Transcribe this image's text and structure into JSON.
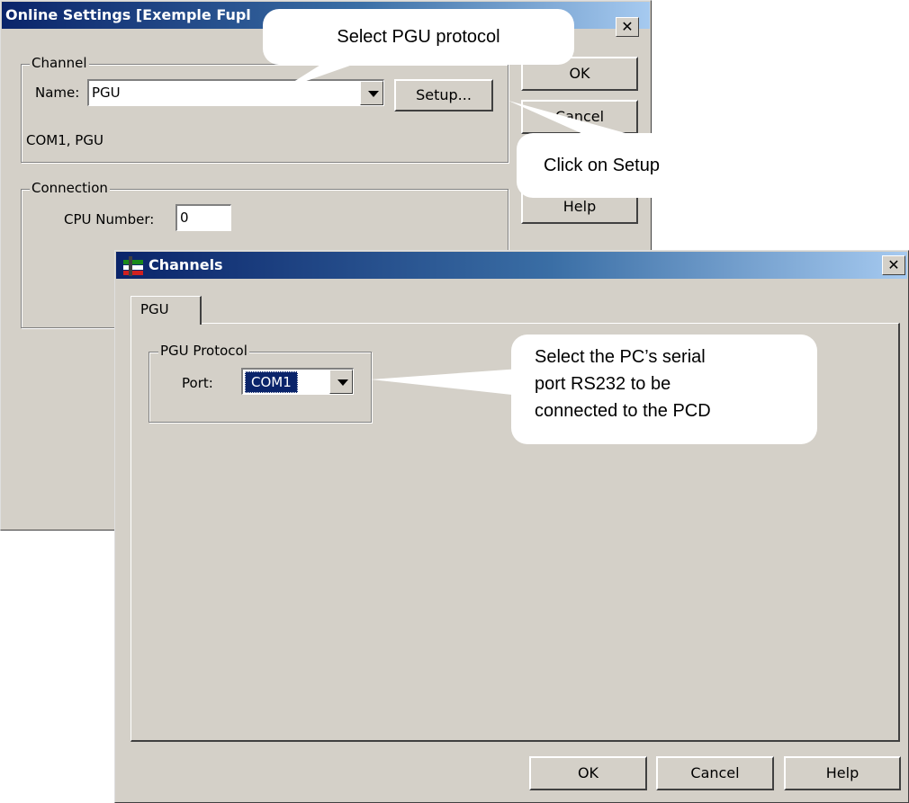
{
  "online_settings": {
    "title": "Online Settings [Exemple Fupl",
    "close_glyph": "✕",
    "channel_group": {
      "label": "Channel",
      "name_label": "Name:",
      "name_value": "PGU",
      "setup_button": "Setup...",
      "status": "COM1, PGU"
    },
    "connection_group": {
      "label": "Connection",
      "cpu_label": "CPU Number:",
      "cpu_value": "0"
    },
    "ok_button": "OK",
    "cancel_button": "Cancel",
    "help_button": "Help"
  },
  "channels": {
    "title": "Channels",
    "close_glyph": "✕",
    "tab_label": "PGU",
    "protocol_group": {
      "label": "PGU Protocol",
      "port_label": "Port:",
      "port_value": "COM1"
    },
    "ok_button": "OK",
    "cancel_button": "Cancel",
    "help_button": "Help"
  },
  "callouts": {
    "select_protocol": "Select PGU protocol",
    "click_setup": "Click on Setup",
    "select_port_line1": "Select the PC’s serial",
    "select_port_line2": "port RS232 to be",
    "select_port_line3": "connected to the PCD"
  },
  "colors": {
    "dialog_face": "#d4d0c8",
    "title_active": "#0a246a",
    "selection": "#0a246a"
  }
}
